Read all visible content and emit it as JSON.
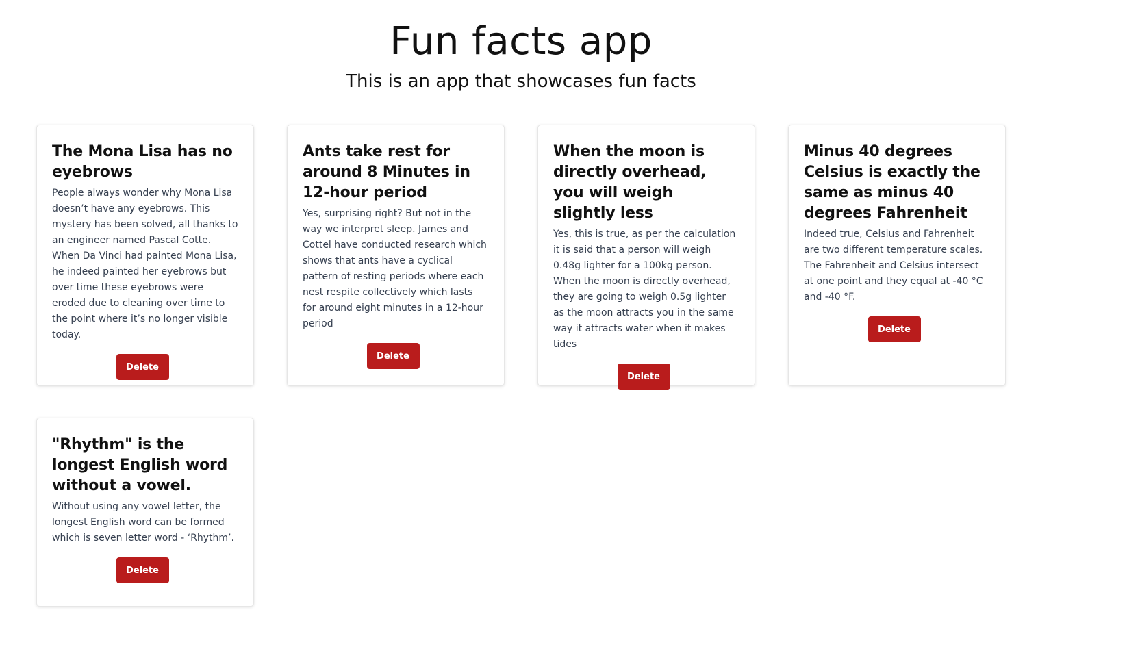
{
  "header": {
    "title": "Fun facts app",
    "subtitle": "This is an app that showcases fun facts"
  },
  "cards": [
    {
      "title": "The Mona Lisa has no eyebrows",
      "body": "People always wonder why Mona Lisa doesn’t have any eyebrows. This mystery has been solved, all thanks to an engineer named Pascal Cotte. When Da Vinci had painted Mona Lisa, he indeed painted her eyebrows but over time these eyebrows were eroded due to cleaning over time to the point where it’s no longer visible today.",
      "delete_label": "Delete"
    },
    {
      "title": "Ants take rest for around 8 Minutes in 12-hour period",
      "body": "Yes, surprising right? But not in the way we interpret sleep. James and Cottel have conducted research which shows that ants have a cyclical pattern of resting periods where each nest respite collectively which lasts for around eight minutes in a 12-hour period",
      "delete_label": "Delete"
    },
    {
      "title": "When the moon is directly overhead, you will weigh slightly less",
      "body": "Yes, this is true, as per the calculation it is said that a person will weigh 0.48g lighter for a 100kg person. When the moon is directly overhead, they are going to weigh 0.5g lighter as the moon attracts you in the same way it attracts water when it makes tides",
      "delete_label": "Delete"
    },
    {
      "title": "Minus 40 degrees Celsius is exactly the same as minus 40 degrees Fahrenheit",
      "body": "Indeed true, Celsius and Fahrenheit are two different temperature scales. The Fahrenheit and Celsius intersect at one point and they equal at -40 °C and -40 °F.",
      "delete_label": "Delete"
    },
    {
      "title": "\"Rhythm\" is the longest English word without a vowel.",
      "body": "Without using any vowel letter, the longest English word can be formed which is seven letter word - ‘Rhythm’.",
      "delete_label": "Delete"
    }
  ],
  "colors": {
    "delete_button": "#b91c1c",
    "card_border": "#e6e6e6",
    "body_text": "#374151"
  }
}
